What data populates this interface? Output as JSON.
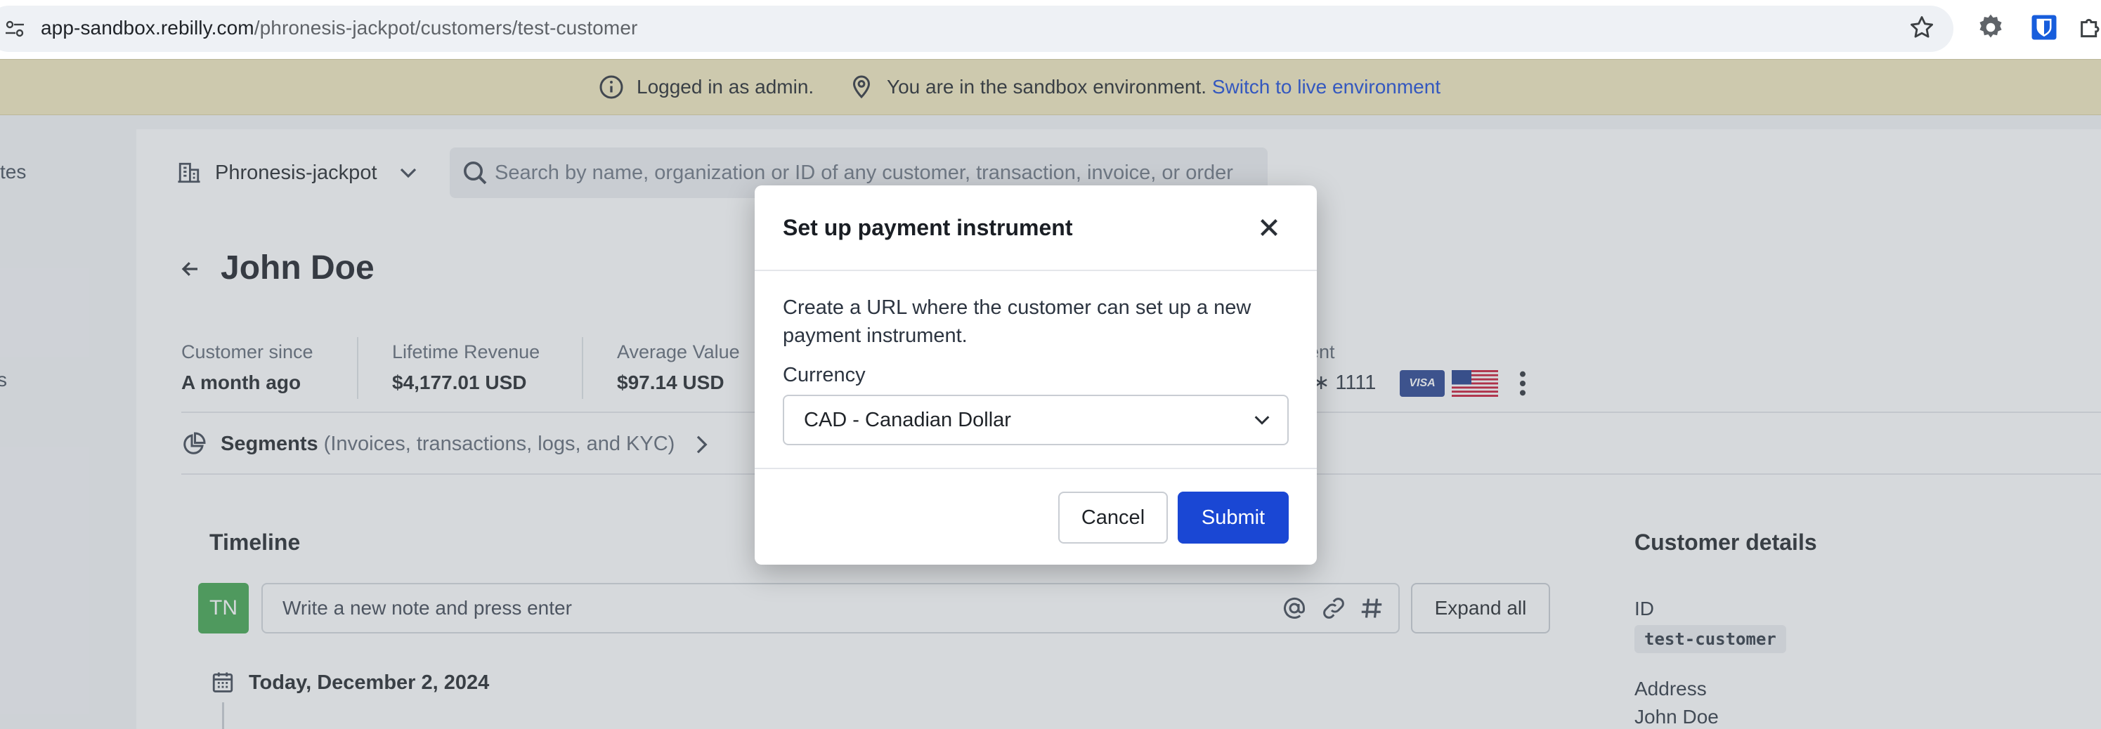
{
  "browser": {
    "url_host": "app-sandbox.rebilly.com",
    "url_path": "/phronesis-jackpot/customers/test-customer",
    "icons": [
      "site-info-icon",
      "star-icon",
      "gear-extension-icon",
      "bitwarden-extension-icon",
      "puzzle-extension-icon"
    ]
  },
  "banner": {
    "logged_in": "Logged in as admin.",
    "sandbox_text": "You are in the sandbox environment.",
    "switch_link": "Switch to live environment"
  },
  "sidebar": {
    "fragment_1": "tes",
    "fragment_2": "s"
  },
  "header": {
    "org_name": "Phronesis-jackpot",
    "search_placeholder": "Search by name, organization or ID of any customer, transaction, invoice, or order"
  },
  "customer": {
    "name": "John Doe",
    "stats": [
      {
        "label": "Customer since",
        "value": "A month ago"
      },
      {
        "label": "Lifetime Revenue",
        "value": "$4,177.01 USD"
      },
      {
        "label": "Average Value",
        "value": "$97.14 USD"
      }
    ],
    "payment_label_fragment": "ent",
    "payment_masked": "∗ 1111",
    "card_brand": "VISA"
  },
  "segments": {
    "title": "Segments",
    "description": "(Invoices, transactions, logs, and KYC)"
  },
  "timeline": {
    "title": "Timeline",
    "avatar_initials": "TN",
    "note_placeholder": "Write a new note and press enter",
    "expand_all": "Expand all",
    "date_heading": "Today, December 2, 2024"
  },
  "details": {
    "title": "Customer details",
    "id_label": "ID",
    "id_value": "test-customer",
    "address_label": "Address",
    "address_value": "John Doe"
  },
  "modal": {
    "title": "Set up payment instrument",
    "description": "Create a URL where the customer can set up a new payment instrument.",
    "currency_label": "Currency",
    "currency_value": "CAD - Canadian Dollar",
    "cancel": "Cancel",
    "submit": "Submit"
  },
  "colors": {
    "banner_bg": "#f2e8be",
    "link_blue": "#1747d6",
    "primary_button": "#1a47d4",
    "avatar_green": "#3ea44b",
    "visa_blue": "#243f8f"
  }
}
